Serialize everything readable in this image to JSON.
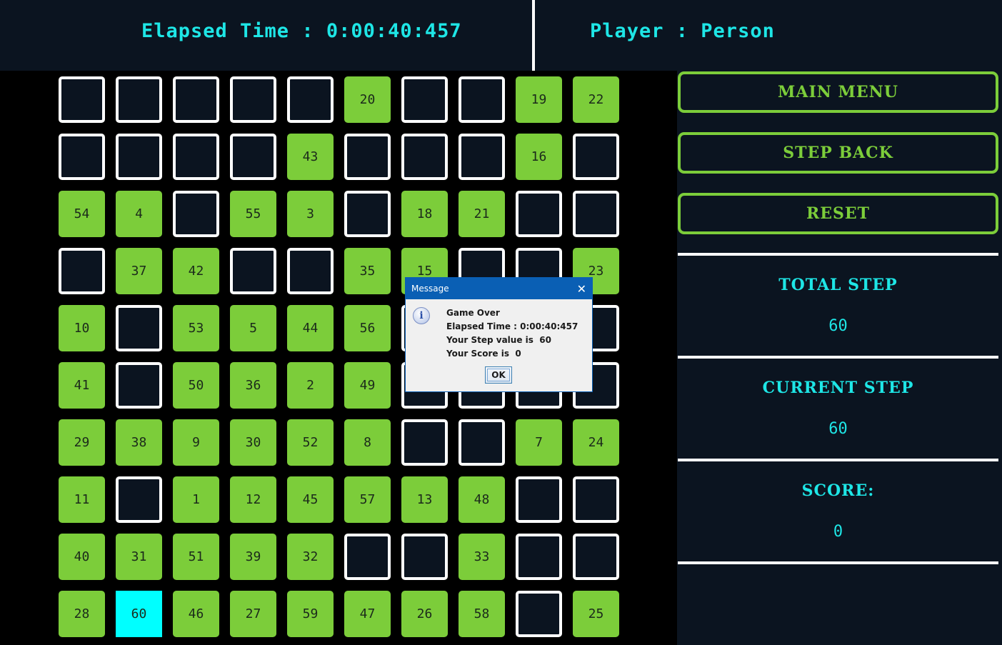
{
  "header": {
    "elapsed": "Elapsed Time : 0:00:40:457",
    "player": "Player : Person"
  },
  "board": {
    "grid": [
      [
        null,
        null,
        null,
        null,
        null,
        20,
        null,
        null,
        19,
        22
      ],
      [
        null,
        null,
        null,
        null,
        43,
        null,
        null,
        null,
        16,
        null
      ],
      [
        54,
        4,
        null,
        55,
        3,
        null,
        18,
        21,
        null,
        null
      ],
      [
        null,
        37,
        42,
        null,
        null,
        35,
        15,
        null,
        null,
        23
      ],
      [
        10,
        null,
        53,
        5,
        44,
        56,
        null,
        null,
        null,
        null
      ],
      [
        41,
        null,
        50,
        36,
        2,
        49,
        null,
        null,
        null,
        null
      ],
      [
        29,
        38,
        9,
        30,
        52,
        8,
        null,
        null,
        7,
        24
      ],
      [
        11,
        null,
        1,
        12,
        45,
        57,
        13,
        48,
        null,
        null
      ],
      [
        40,
        31,
        51,
        39,
        32,
        null,
        null,
        33,
        null,
        null
      ],
      [
        28,
        60,
        46,
        27,
        59,
        47,
        26,
        58,
        null,
        25
      ]
    ],
    "current_step_value": 60
  },
  "side": {
    "main_menu": "MAIN MENU",
    "step_back": "STEP BACK",
    "reset": "RESET",
    "total_step_label": "TOTAL STEP",
    "total_step_value": "60",
    "current_step_label": "CURRENT STEP",
    "current_step_value": "60",
    "score_label": "SCORE:",
    "score_value": "0"
  },
  "dialog": {
    "title": "Message",
    "close": "✕",
    "icon": "i",
    "line1": "Game Over",
    "line2": "Elapsed Time : 0:00:40:457",
    "line3": "Your Step value is  60",
    "line4": "Your Score is  0",
    "ok": "OK"
  },
  "colors": {
    "background": "#0b1420",
    "filled_cell": "#7ccd3a",
    "current_cell": "#00ffff",
    "accent_text": "#1ee6e6",
    "button_border": "#7ccd3a",
    "dialog_titlebar": "#0a5fb4"
  }
}
